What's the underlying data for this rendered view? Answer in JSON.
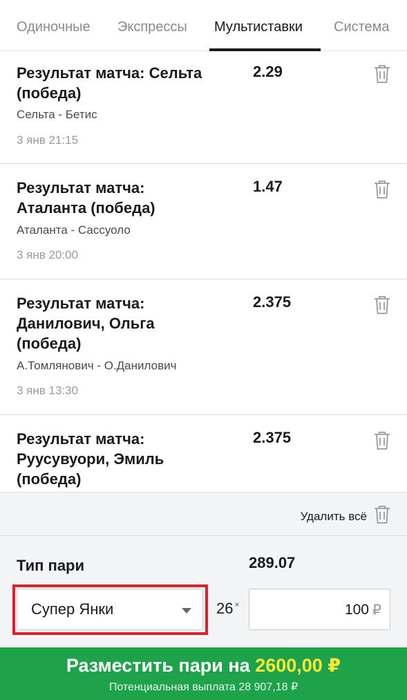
{
  "tabs": [
    {
      "label": "Одиночные"
    },
    {
      "label": "Экспрессы"
    },
    {
      "label": "Мультиставки"
    },
    {
      "label": "Система"
    }
  ],
  "active_tab": "Мультиставки",
  "bets": [
    {
      "title_lines": [
        "Результат матча: Сельта",
        "(победа)"
      ],
      "odds": "2.29",
      "event": "Сельта - Бетис",
      "time": "3 янв 21:15"
    },
    {
      "title_lines": [
        "Результат матча:",
        "Аталанта (победа)"
      ],
      "odds": "1.47",
      "event": "Аталанта - Сассуоло",
      "time": "3 янв 20:00"
    },
    {
      "title_lines": [
        "Результат матча:",
        "Данилович, Ольга",
        "(победа)"
      ],
      "odds": "2.375",
      "event": "А.Томлянович - О.Данилович",
      "time": "3 янв 13:30"
    },
    {
      "title_lines": [
        "Результат матча:",
        "Руусувуори, Эмиль",
        "(победа)"
      ],
      "odds": "2.375"
    }
  ],
  "delete_all_label": "Удалить всё",
  "bet_type": {
    "label": "Тип пари",
    "total_odds": "289.07",
    "selected": "Супер Янки",
    "multiplier": "26",
    "multiplier_sign": "×"
  },
  "stake": {
    "value": "100",
    "currency": "₽"
  },
  "place_button": {
    "label": "Разместить пари на",
    "amount": "2600,00 ₽",
    "potential_payout": "Потенциальная выплата 28 907,18 ₽"
  },
  "colors": {
    "accent_green": "#1ea34a",
    "amount_yellow": "#f5e83a",
    "highlight_red": "#e0202b"
  },
  "icons": {
    "trash": "trash-icon",
    "dropdown": "chevron-down-icon"
  }
}
